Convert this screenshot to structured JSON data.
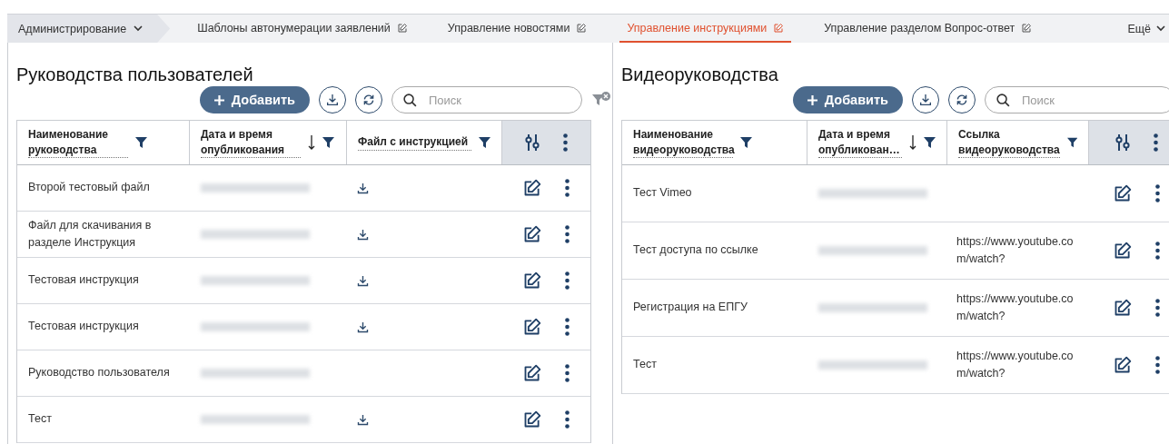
{
  "nav": {
    "root": "Администрирование",
    "tabs": [
      {
        "label": "Шаблоны автонумерации заявлений",
        "selected": false
      },
      {
        "label": "Управление новостями",
        "selected": false
      },
      {
        "label": "Управление инструкциями",
        "selected": true
      },
      {
        "label": "Управление разделом Вопрос-ответ",
        "selected": false
      }
    ],
    "more": "Ещё"
  },
  "panels": [
    {
      "title": "Руководства пользователей",
      "kind": "files",
      "add_button": "Добавить",
      "search": {
        "placeholder": "Поиск"
      },
      "columns": [
        {
          "label": "Наименование руководства",
          "sorted_desc": false
        },
        {
          "label": "Дата и время опубликования",
          "sorted_desc": true
        },
        {
          "label": "Файл с инструкцией",
          "sorted_desc": false
        }
      ],
      "rows": [
        {
          "name": "Второй тестовый файл",
          "has_file": true
        },
        {
          "name": "Файл для скачивания в разделе Инструкция",
          "has_file": true
        },
        {
          "name": "Тестовая инструкция",
          "has_file": true
        },
        {
          "name": "Тестовая инструкция",
          "has_file": true
        },
        {
          "name": "Руководство пользователя",
          "has_file": false
        },
        {
          "name": "Тест",
          "has_file": true
        }
      ]
    },
    {
      "title": "Видеоруководства",
      "kind": "links",
      "add_button": "Добавить",
      "search": {
        "placeholder": "Поиск"
      },
      "columns": [
        {
          "label": "Наименование видеоруководства",
          "sorted_desc": false
        },
        {
          "label": "Дата и время опубликован…",
          "sorted_desc": true
        },
        {
          "label": "Ссылка видеоруководства",
          "sorted_desc": false
        }
      ],
      "rows": [
        {
          "name": "Тест Vimeo"
        },
        {
          "name": "Тест доступа по ссылке",
          "link": "https://www.youtube.com/watch?"
        },
        {
          "name": "Регистрация на ЕПГУ",
          "link": "https://www.youtube.com/watch?"
        },
        {
          "name": "Тест",
          "link": "https://www.youtube.com/watch?"
        }
      ]
    }
  ]
}
